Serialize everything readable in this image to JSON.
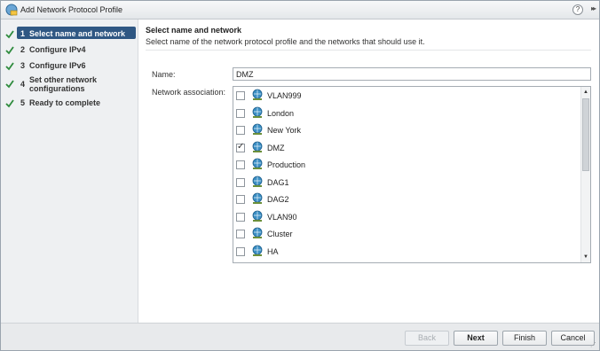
{
  "window": {
    "title": "Add Network Protocol Profile",
    "help_label": "?",
    "expand_label": "▸▸"
  },
  "steps": [
    {
      "num": "1",
      "label": "Select name and network",
      "completed": true,
      "active": true
    },
    {
      "num": "2",
      "label": "Configure IPv4",
      "completed": true,
      "active": false
    },
    {
      "num": "3",
      "label": "Configure IPv6",
      "completed": true,
      "active": false
    },
    {
      "num": "4",
      "label": "Set other network configurations",
      "completed": true,
      "active": false
    },
    {
      "num": "5",
      "label": "Ready to complete",
      "completed": true,
      "active": false
    }
  ],
  "content": {
    "title": "Select name and network",
    "description": "Select name of the network protocol profile and the networks that should use it.",
    "name_label": "Name:",
    "name_value": "DMZ",
    "association_label": "Network association:",
    "networks": [
      {
        "name": "VLAN999",
        "checked": false
      },
      {
        "name": "London",
        "checked": false
      },
      {
        "name": "New York",
        "checked": false
      },
      {
        "name": "DMZ",
        "checked": true
      },
      {
        "name": "Production",
        "checked": false
      },
      {
        "name": "DAG1",
        "checked": false
      },
      {
        "name": "DAG2",
        "checked": false
      },
      {
        "name": "VLAN90",
        "checked": false
      },
      {
        "name": "Cluster",
        "checked": false
      },
      {
        "name": "HA",
        "checked": false
      }
    ]
  },
  "footer": {
    "back_label": "Back",
    "next_label": "Next",
    "finish_label": "Finish",
    "cancel_label": "Cancel"
  },
  "colors": {
    "active_step_bg": "#2f5783",
    "check_green": "#2e8b3d",
    "network_icon": "#3a8fc4"
  }
}
